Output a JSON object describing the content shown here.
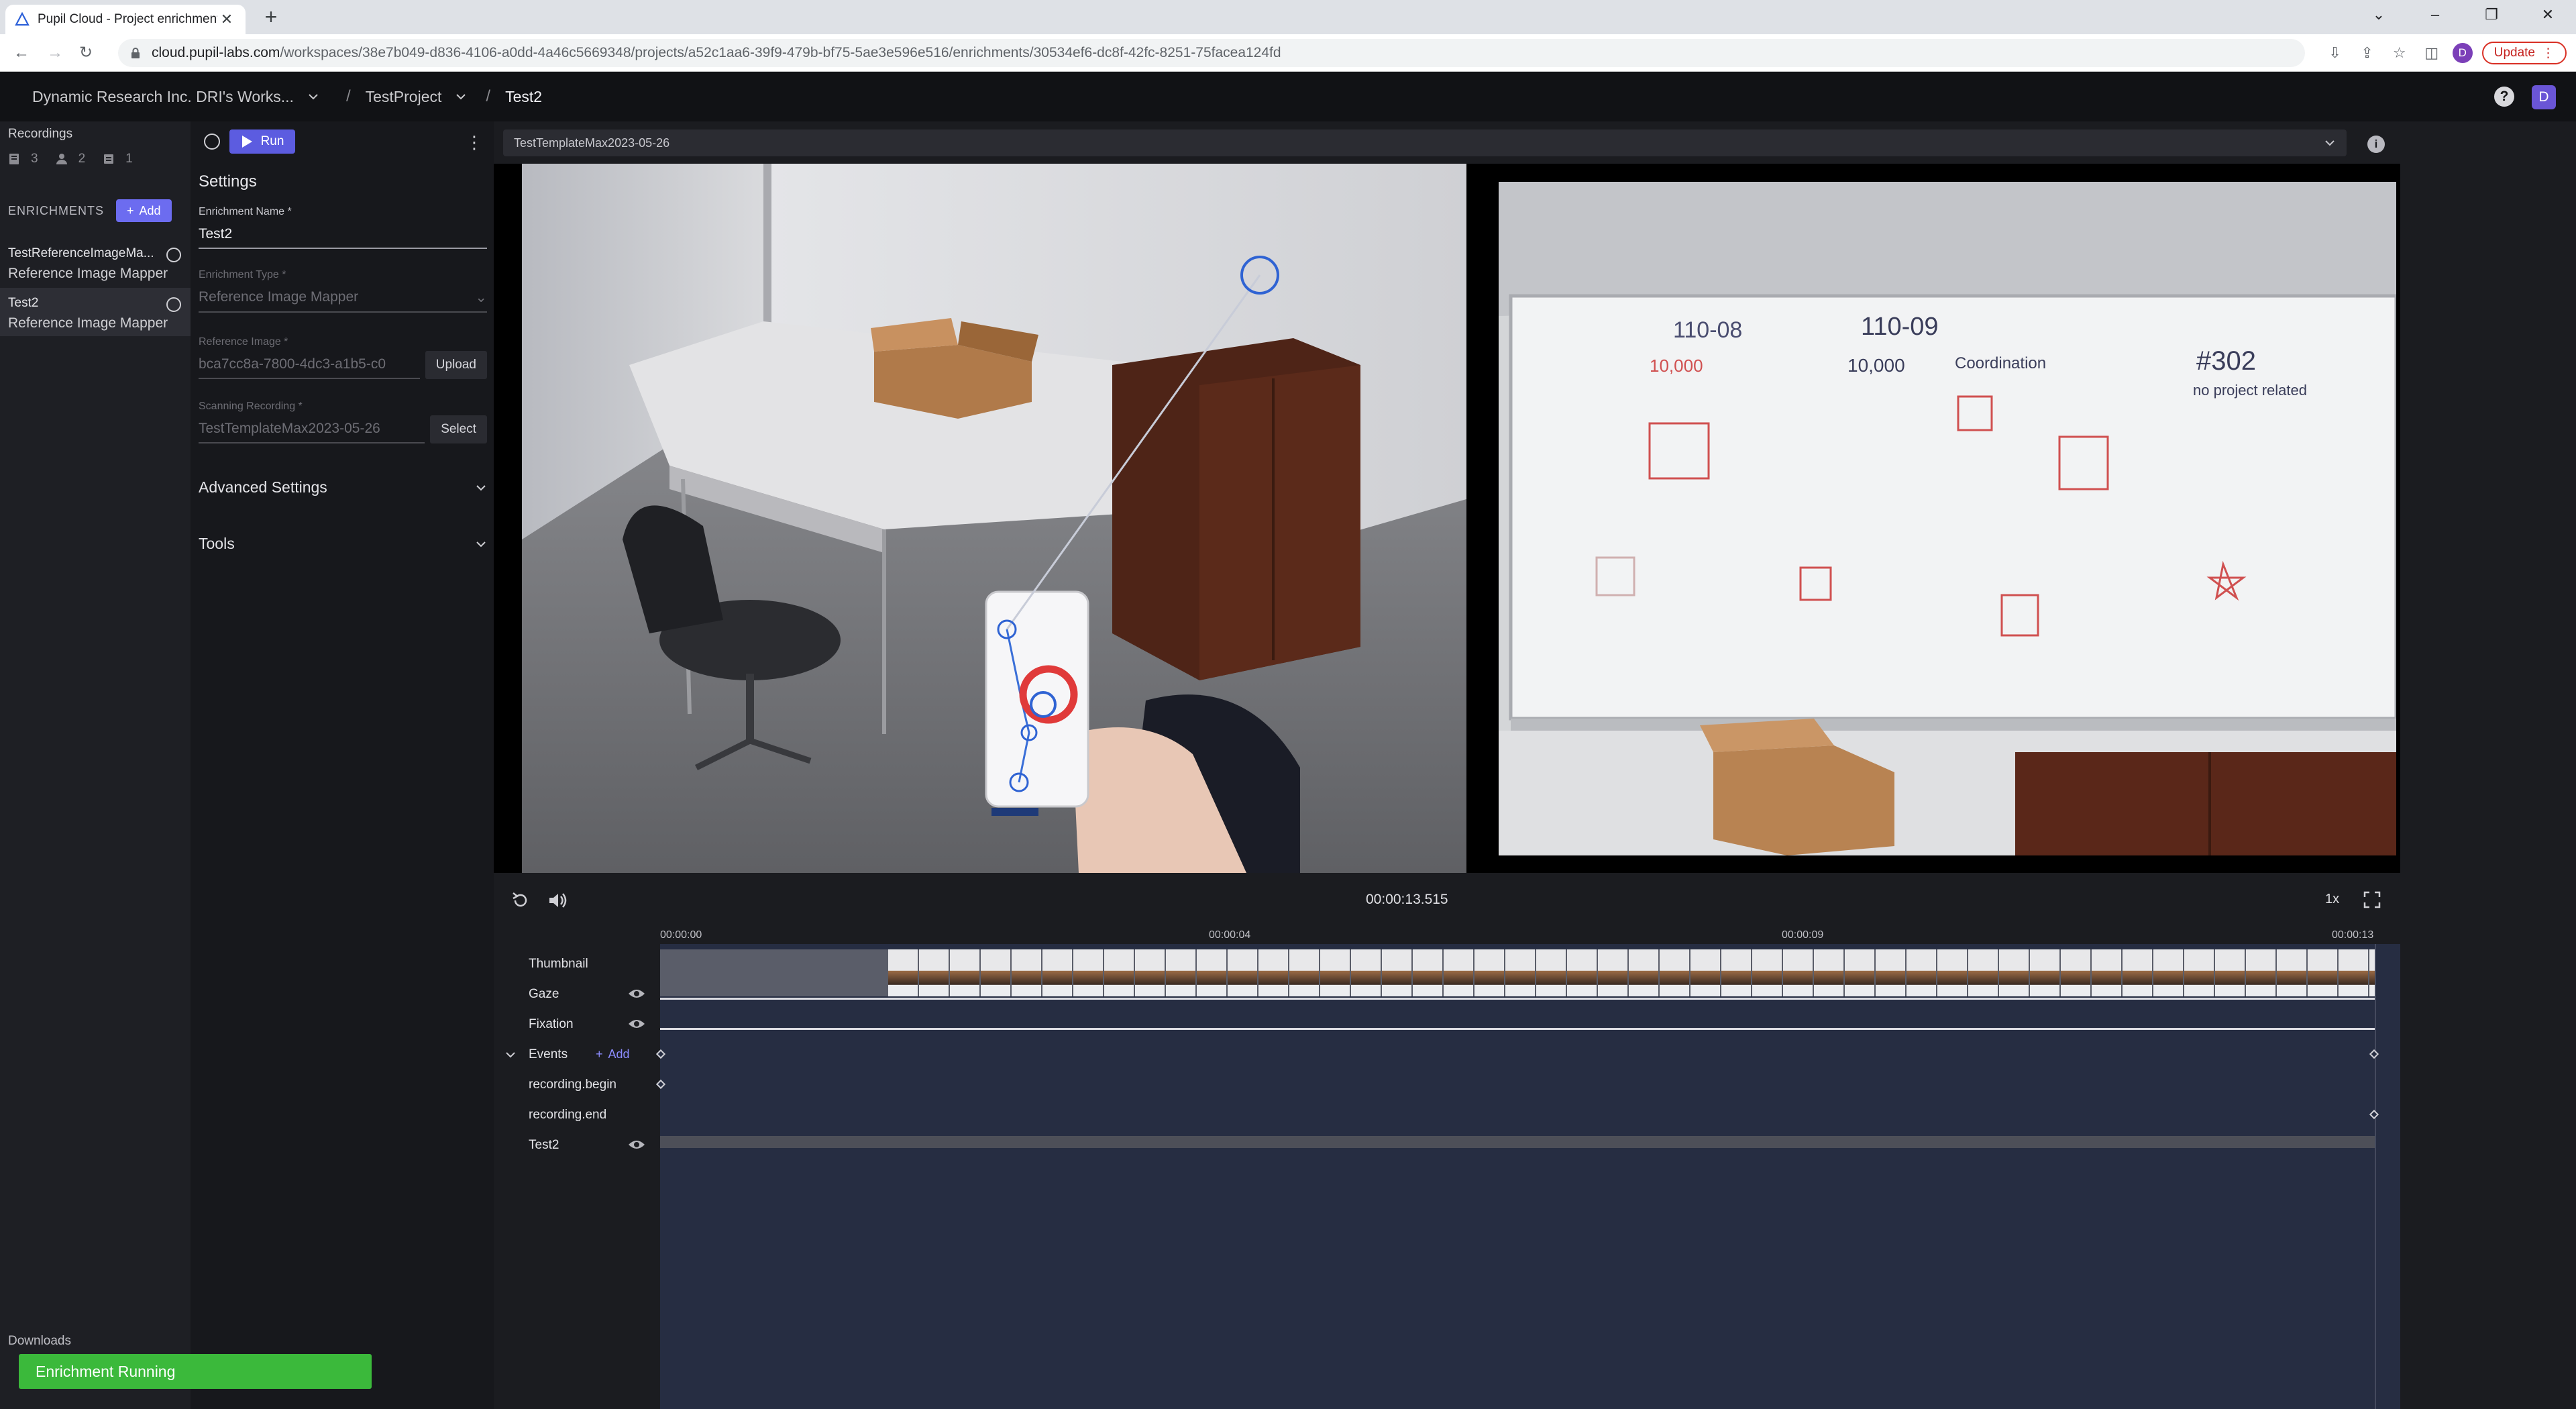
{
  "browser": {
    "tab_title": "Pupil Cloud - Project enrichment",
    "url_host": "cloud.pupil-labs.com",
    "url_path": "/workspaces/38e7b049-d836-4106-a0dd-4a46c5669348/projects/a52c1aa6-39f9-479b-bf75-5ae3e596e516/enrichments/30534ef6-dc8f-42fc-8251-75facea124fd",
    "profile_initial": "D",
    "update_label": "Update"
  },
  "header": {
    "workspace": "Dynamic Research Inc. DRI's Works...",
    "project": "TestProject",
    "enrichment": "Test2",
    "help": "?",
    "user_initial": "D"
  },
  "sidebar": {
    "recordings_title": "Recordings",
    "stats": {
      "recordings": "3",
      "wearers": "2",
      "templates": "1"
    },
    "enrichments_label": "ENRICHMENTS",
    "add_label": "Add",
    "items": [
      {
        "name": "TestReferenceImageMa...",
        "type": "Reference Image Mapper"
      },
      {
        "name": "Test2",
        "type": "Reference Image Mapper"
      }
    ],
    "downloads_label": "Downloads",
    "status_toast": "Enrichment Running"
  },
  "settings": {
    "run_label": "Run",
    "title": "Settings",
    "name_label": "Enrichment Name *",
    "name_value": "Test2",
    "type_label": "Enrichment Type *",
    "type_value": "Reference Image Mapper",
    "ref_label": "Reference Image *",
    "ref_value": "bca7cc8a-7800-4dc3-a1b5-c0",
    "upload_label": "Upload",
    "scan_label": "Scanning Recording *",
    "scan_value": "TestTemplateMax2023-05-26",
    "select_label": "Select",
    "advanced_label": "Advanced Settings",
    "tools_label": "Tools"
  },
  "player": {
    "recording": "TestTemplateMax2023-05-26",
    "timecode": "00:00:13.515",
    "speed": "1x"
  },
  "timeline": {
    "ticks": [
      "00:00:00",
      "00:00:04",
      "00:00:09",
      "00:00:13"
    ],
    "tracks": {
      "thumbnail": "Thumbnail",
      "gaze": "Gaze",
      "fixation": "Fixation",
      "events": "Events",
      "events_add": "Add",
      "begin": "recording.begin",
      "end": "recording.end",
      "test2": "Test2"
    }
  },
  "whiteboard": {
    "left_code": "110-08",
    "right_code": "110-09",
    "amount": "10,000",
    "word": "Coordination",
    "note": "#302",
    "sub_note": "no project related"
  }
}
